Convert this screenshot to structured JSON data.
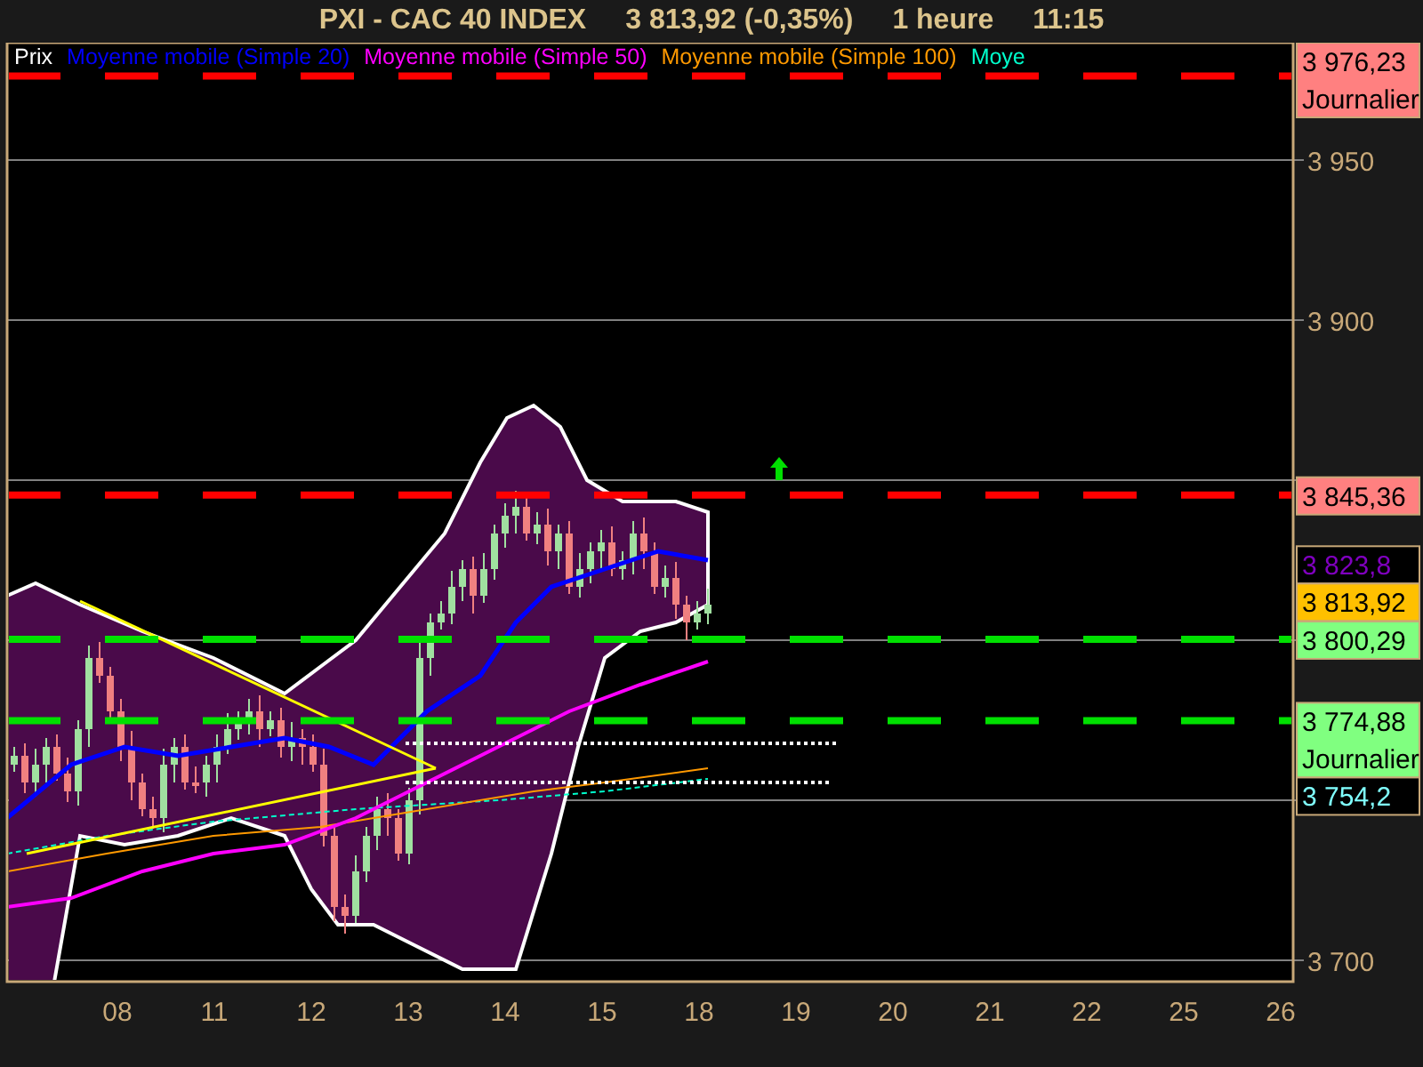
{
  "title": {
    "symbol": "PXI - CAC 40 INDEX",
    "price": "3 813,92 (-0,35%)",
    "timeframe": "1 heure",
    "time": "11:15"
  },
  "legend": [
    {
      "label": "Prix",
      "color": "#ffffff"
    },
    {
      "label": "Moyenne mobile (Simple 20)",
      "color": "#0000ff"
    },
    {
      "label": "Moyenne mobile (Simple 50)",
      "color": "#ff00ff"
    },
    {
      "label": "Moyenne mobile (Simple 100)",
      "color": "#ff9900"
    },
    {
      "label": "Moye",
      "color": "#00ffcc"
    }
  ],
  "y_axis": [
    "3 950",
    "3 900",
    "3 700"
  ],
  "x_axis": [
    "08",
    "11",
    "12",
    "13",
    "14",
    "15",
    "18",
    "19",
    "20",
    "21",
    "22",
    "25",
    "26"
  ],
  "price_tags": [
    {
      "value": "3 976,23",
      "sublabel": "Journalier",
      "kind": "level",
      "color": "#ff8080"
    },
    {
      "value": "3 845,36",
      "kind": "level",
      "color": "#ff8080"
    },
    {
      "value": "3 823,8",
      "kind": "indicator",
      "color": "#8000c0"
    },
    {
      "value": "3 813,92",
      "kind": "price",
      "color": "#ffc000"
    },
    {
      "value": "3 800,29",
      "kind": "level",
      "color": "#80ff80"
    },
    {
      "value": "3 774,88",
      "sublabel": "Journalier",
      "kind": "level",
      "color": "#80ff80"
    },
    {
      "value": "3 754,2",
      "kind": "indicator",
      "color": "#80ffff"
    }
  ]
}
